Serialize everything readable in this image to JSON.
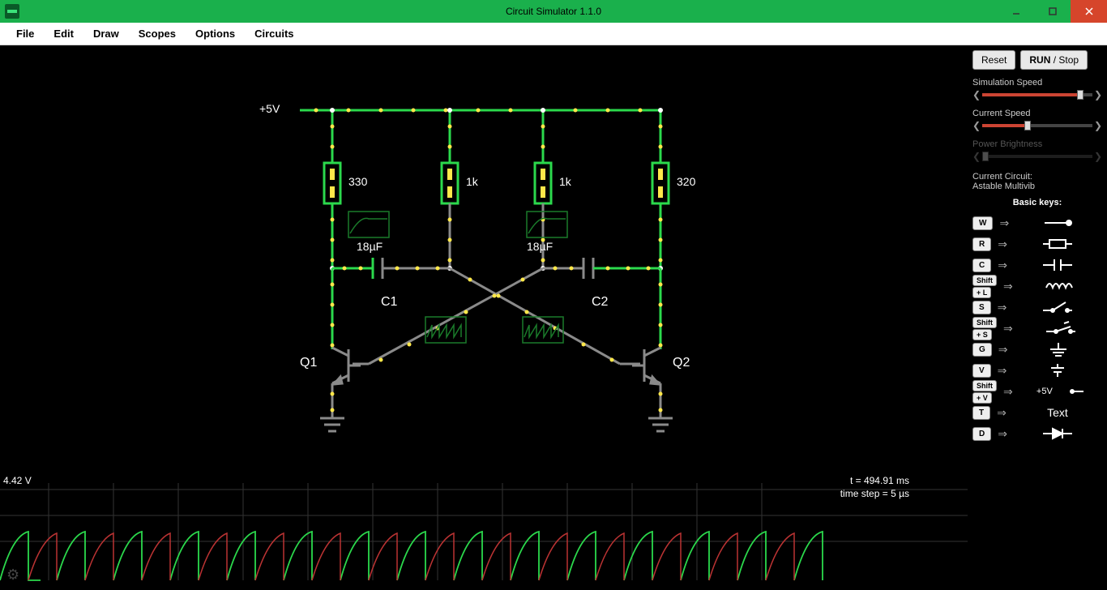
{
  "titlebar": {
    "title": "Circuit Simulator 1.1.0"
  },
  "menu": {
    "file": "File",
    "edit": "Edit",
    "draw": "Draw",
    "scopes": "Scopes",
    "options": "Options",
    "circuits": "Circuits"
  },
  "controls": {
    "reset": "Reset",
    "run": "RUN",
    "stop": "/ Stop"
  },
  "sliders": {
    "sim_speed": {
      "label": "Simulation Speed",
      "value": 0.88
    },
    "current_speed": {
      "label": "Current Speed",
      "value": 0.4
    },
    "power_brightness": {
      "label": "Power Brightness",
      "value": 0.0,
      "disabled": true
    }
  },
  "circuit_info": {
    "label": "Current Circuit:",
    "name": "Astable Multivib"
  },
  "keys_header": "Basic keys:",
  "keys": [
    {
      "k": [
        "W"
      ],
      "sym": "wire"
    },
    {
      "k": [
        "R"
      ],
      "sym": "resistor"
    },
    {
      "k": [
        "C"
      ],
      "sym": "capacitor"
    },
    {
      "k": [
        "Shift",
        "+ L"
      ],
      "sym": "inductor"
    },
    {
      "k": [
        "S"
      ],
      "sym": "switch-open"
    },
    {
      "k": [
        "Shift",
        "+ S"
      ],
      "sym": "switch-closed"
    },
    {
      "k": [
        "G"
      ],
      "sym": "ground"
    },
    {
      "k": [
        "V"
      ],
      "sym": "vsource"
    },
    {
      "k": [
        "Shift",
        "+ V"
      ],
      "sym": "vlabel",
      "text": "+5V"
    },
    {
      "k": [
        "T"
      ],
      "sym": "text",
      "text": "Text"
    },
    {
      "k": [
        "D"
      ],
      "sym": "diode"
    }
  ],
  "circuit": {
    "vlabel": "+5V",
    "r1": "330",
    "r2": "1k",
    "r3": "1k",
    "r4": "320",
    "c1v": "18µF",
    "c2v": "18µF",
    "c1": "C1",
    "c2": "C2",
    "q1": "Q1",
    "q2": "Q2"
  },
  "scope": {
    "voltage": "4.42 V",
    "time": "t = 494.91 ms",
    "step": "time step = 5 µs"
  }
}
